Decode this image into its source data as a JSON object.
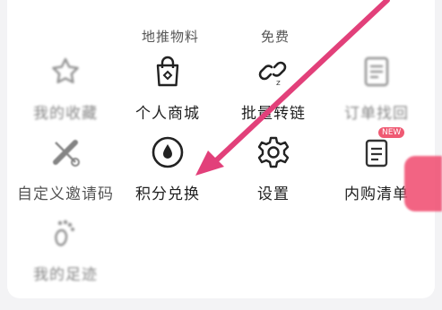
{
  "top_row": {
    "item0": "",
    "item1": "地推物料",
    "item2": "免费"
  },
  "row2": [
    {
      "label": "我的收藏",
      "icon": "star-icon"
    },
    {
      "label": "个人商城",
      "icon": "shopping-bag-icon"
    },
    {
      "label": "批量转链",
      "icon": "link-icon"
    },
    {
      "label": "订单找回",
      "icon": "order-document-icon"
    }
  ],
  "row3": [
    {
      "label": "自定义邀请码",
      "icon": "pencil-ruler-icon"
    },
    {
      "label": "积分兑换",
      "icon": "points-drop-icon"
    },
    {
      "label": "设置",
      "icon": "gear-icon"
    },
    {
      "label": "内购清单",
      "icon": "checklist-icon",
      "badge": "NEW"
    }
  ],
  "row4": [
    {
      "label": "我的足迹",
      "icon": "footprint-icon"
    }
  ],
  "colors": {
    "annotation_arrow": "#e2407a",
    "accent": "#ef5a73"
  }
}
